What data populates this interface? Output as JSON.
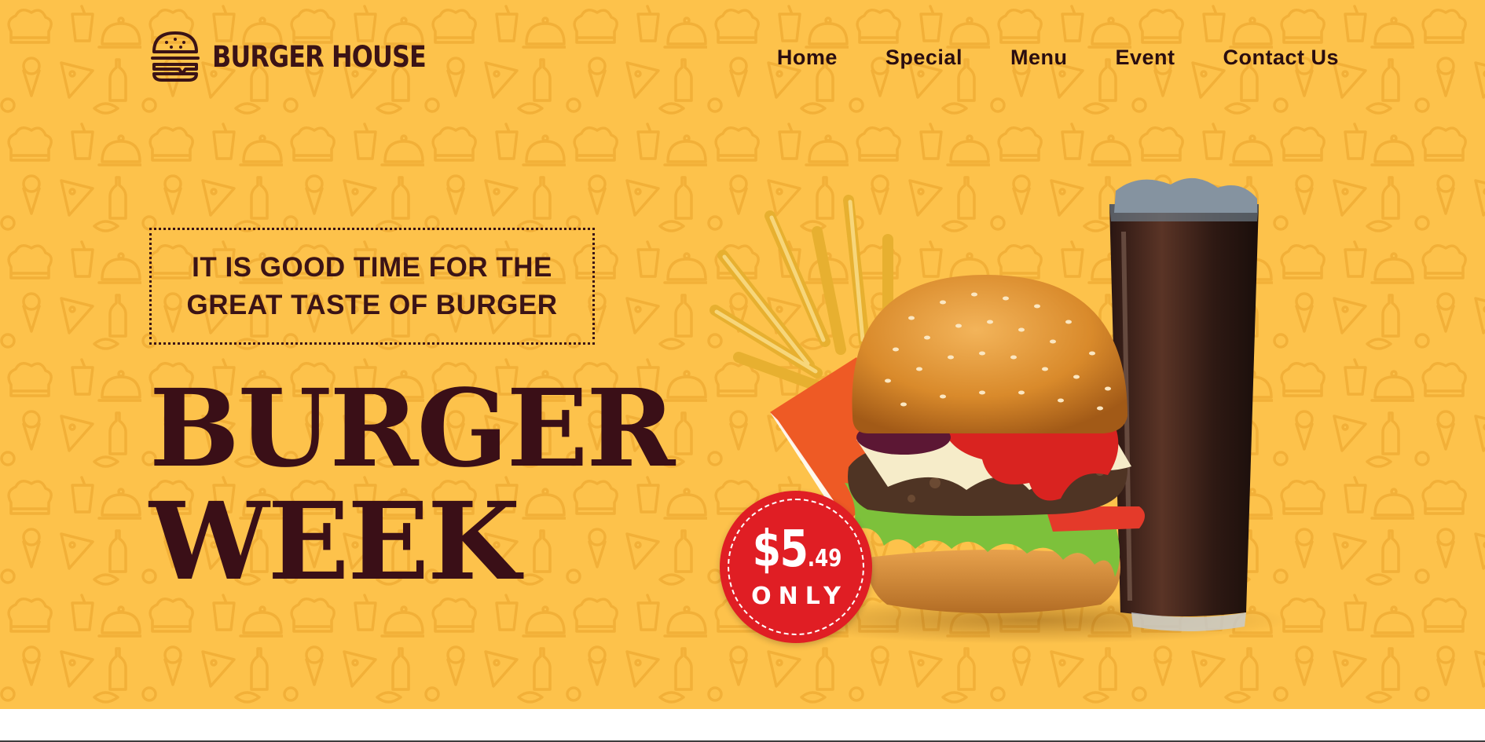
{
  "header": {
    "logo_text": "BURGER HOUSE",
    "logo_icon": "burger-icon",
    "nav": [
      {
        "label": "Home"
      },
      {
        "label": "Special"
      },
      {
        "label": "Menu"
      },
      {
        "label": "Event"
      },
      {
        "label": "Contact Us"
      }
    ]
  },
  "hero": {
    "tagline_line1": "IT IS GOOD TIME FOR THE",
    "tagline_line2": "GREAT TASTE OF BURGER",
    "headline_line1": "BURGER",
    "headline_line2": "WEEK",
    "images": [
      "french-fries",
      "cheeseburger",
      "cola-glass"
    ]
  },
  "price_badge": {
    "amount": "$5",
    "cents": ".49",
    "label": "ONLY"
  },
  "colors": {
    "background": "#fdc24b",
    "pattern": "#f4b43c",
    "text_dark": "#3b1316",
    "badge_red": "#e01e24"
  }
}
